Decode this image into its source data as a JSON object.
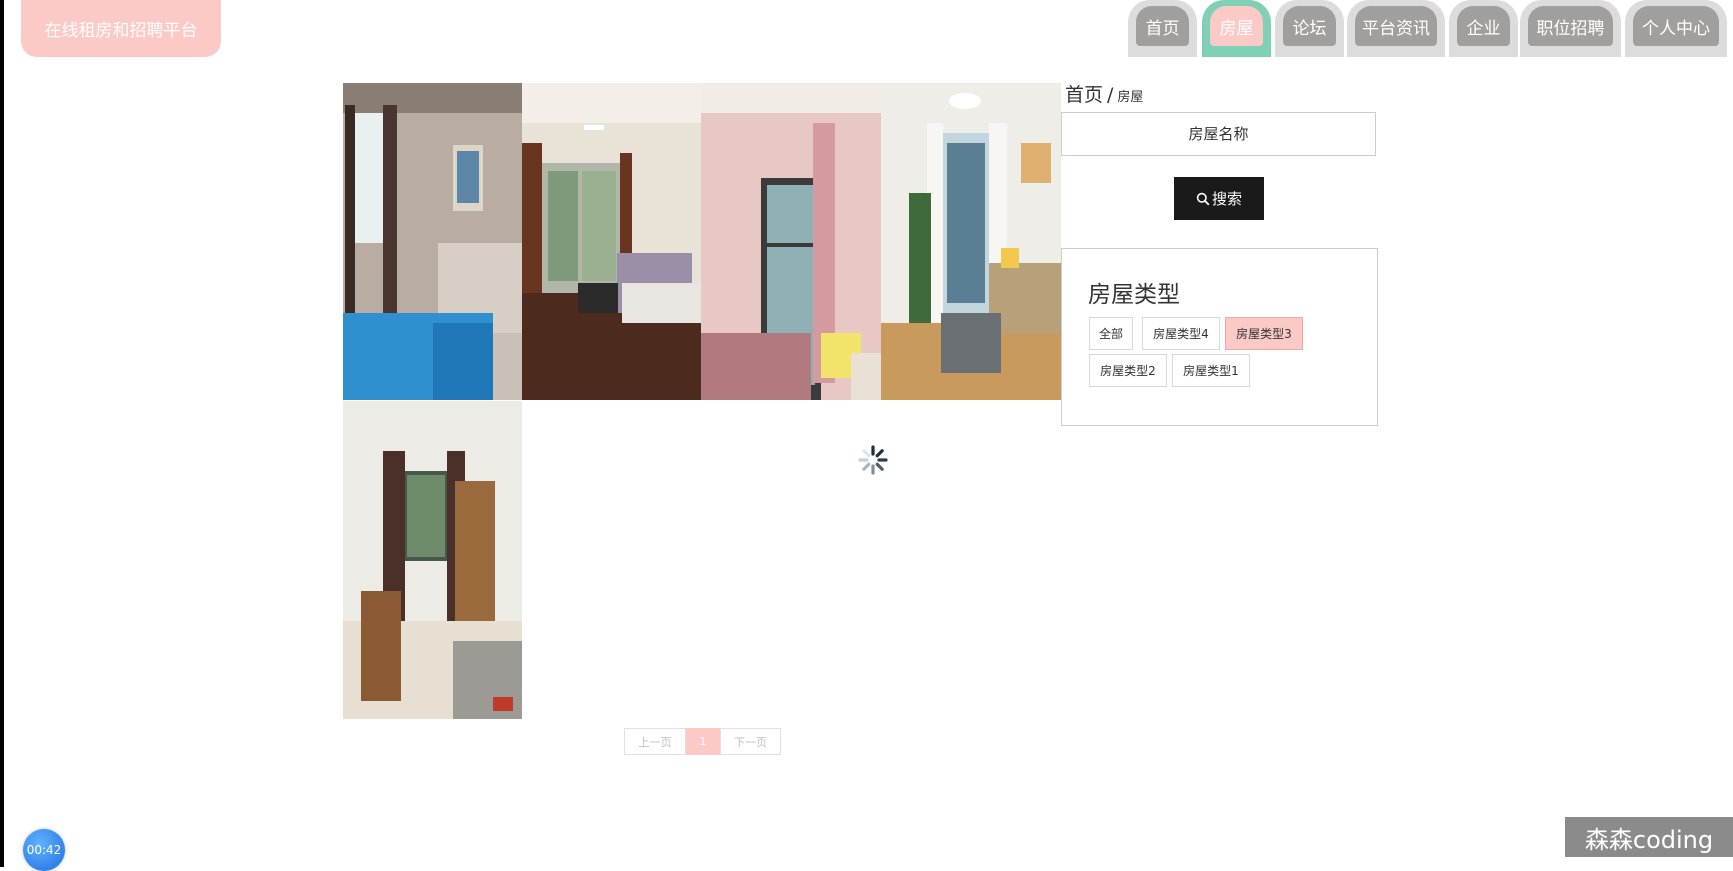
{
  "app": {
    "title": "在线租房和招聘平台"
  },
  "nav": {
    "items": [
      {
        "label": "首页",
        "active": false
      },
      {
        "label": "房屋",
        "active": true
      },
      {
        "label": "论坛",
        "active": false
      },
      {
        "label": "平台资讯",
        "active": false
      },
      {
        "label": "企业",
        "active": false
      },
      {
        "label": "职位招聘",
        "active": false
      },
      {
        "label": "个人中心",
        "active": false
      }
    ]
  },
  "breadcrumb": {
    "home": "首页",
    "separator": "/",
    "current": "房屋"
  },
  "search": {
    "placeholder": "房屋名称",
    "button_label": "搜索",
    "icon": "search-icon"
  },
  "house_types": {
    "title": "房屋类型",
    "options": [
      {
        "label": "全部",
        "active": false
      },
      {
        "label": "房屋类型4",
        "active": false
      },
      {
        "label": "房屋类型3",
        "active": true
      },
      {
        "label": "房屋类型2",
        "active": false
      },
      {
        "label": "房屋类型1",
        "active": false
      }
    ]
  },
  "listings": [
    {
      "image": "bedroom-with-blue-bed-photo"
    },
    {
      "image": "living-room-with-sofa-photo"
    },
    {
      "image": "pink-bedroom-with-window-photo"
    },
    {
      "image": "bright-living-room-photo"
    },
    {
      "image": "small-bedroom-with-wardrobe-photo"
    }
  ],
  "pagination": {
    "prev_label": "上一页",
    "current_page": "1",
    "next_label": "下一页"
  },
  "overlay": {
    "timer": "00:42",
    "watermark": "森森coding"
  },
  "colors": {
    "accent_pink": "#fbc9c6",
    "nav_gray": "#a19e9e",
    "active_tab_border": "#7fd0b4",
    "button_dark": "#1a1a1a"
  }
}
